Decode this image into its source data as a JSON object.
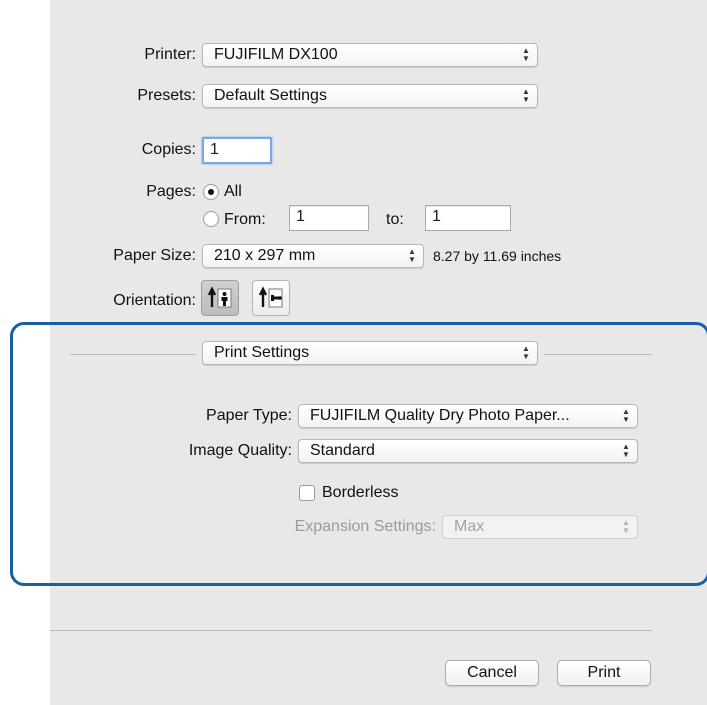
{
  "printer": {
    "label": "Printer:",
    "value": "FUJIFILM DX100"
  },
  "presets": {
    "label": "Presets:",
    "value": "Default Settings"
  },
  "copies": {
    "label": "Copies:",
    "value": "1"
  },
  "pages": {
    "label": "Pages:",
    "all_label": "All",
    "all_selected": true,
    "from_label": "From:",
    "from_value": "1",
    "to_label": "to:",
    "to_value": "1"
  },
  "paper_size": {
    "label": "Paper Size:",
    "value": "210 x 297 mm",
    "dimensions": "8.27 by 11.69 inches"
  },
  "orientation": {
    "label": "Orientation:",
    "selected": "portrait"
  },
  "section_popup": {
    "value": "Print Settings"
  },
  "paper_type": {
    "label": "Paper Type:",
    "value": "FUJIFILM Quality Dry Photo Paper..."
  },
  "image_quality": {
    "label": "Image Quality:",
    "value": "Standard"
  },
  "borderless": {
    "label": "Borderless",
    "checked": false
  },
  "expansion": {
    "label": "Expansion Settings:",
    "value": "Max",
    "disabled": true
  },
  "buttons": {
    "cancel": "Cancel",
    "print": "Print"
  },
  "colors": {
    "highlight_border": "#1a5fa6",
    "focus_ring": "#7aa7e6",
    "panel_bg": "#e8e8e8"
  }
}
